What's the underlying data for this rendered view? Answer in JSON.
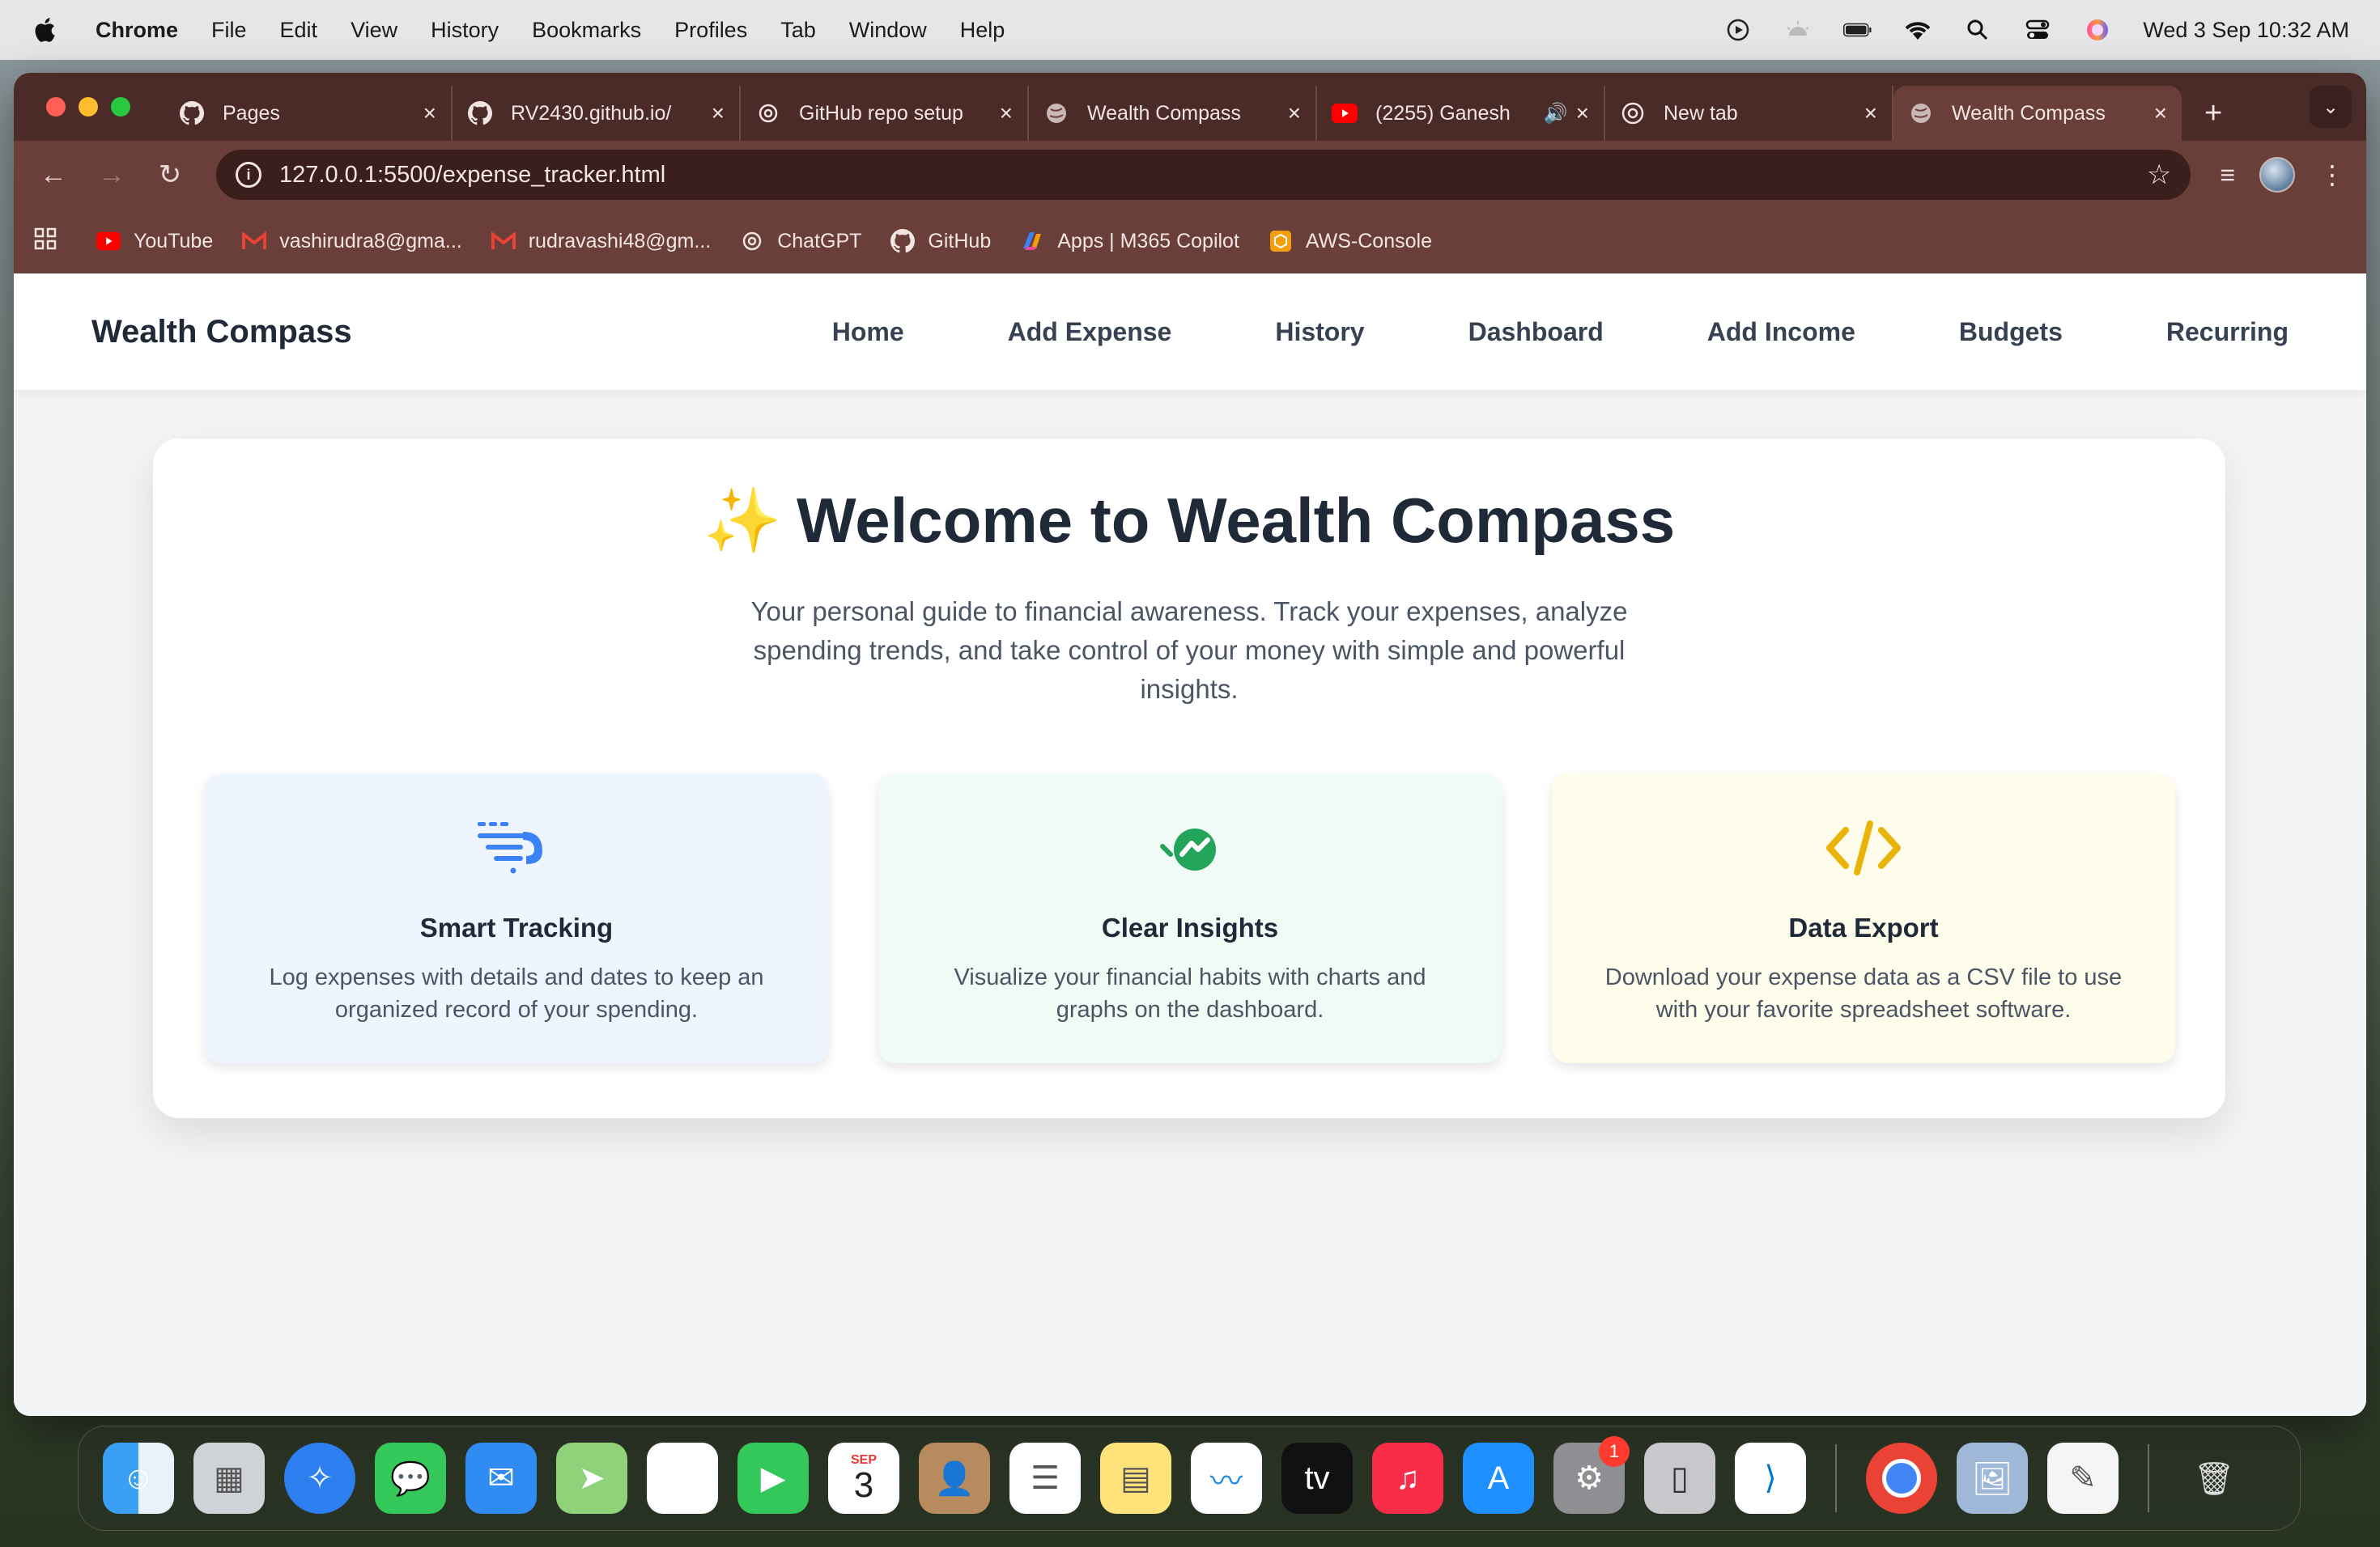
{
  "menubar": {
    "app": "Chrome",
    "items": [
      "File",
      "Edit",
      "View",
      "History",
      "Bookmarks",
      "Profiles",
      "Tab",
      "Window",
      "Help"
    ],
    "clock": "Wed 3 Sep  10:32 AM"
  },
  "tabs": [
    {
      "title": "Pages",
      "icon": "github-icon"
    },
    {
      "title": "RV2430.github.io/",
      "icon": "github-icon"
    },
    {
      "title": "GitHub repo setup",
      "icon": "chatgpt-icon"
    },
    {
      "title": "Wealth Compass",
      "icon": "globe-icon"
    },
    {
      "title": "(2255) Ganesh",
      "icon": "youtube-icon"
    },
    {
      "title": "New tab",
      "icon": "chrome-icon"
    },
    {
      "title": "Wealth Compass",
      "icon": "globe-icon",
      "active": true
    }
  ],
  "omnibox": {
    "url": "127.0.0.1:5500/expense_tracker.html"
  },
  "bookmarks": [
    {
      "label": "YouTube",
      "icon": "youtube-icon"
    },
    {
      "label": "vashirudra8@gma...",
      "icon": "gmail-icon"
    },
    {
      "label": "rudravashi48@gm...",
      "icon": "gmail-icon"
    },
    {
      "label": "ChatGPT",
      "icon": "chatgpt-icon"
    },
    {
      "label": "GitHub",
      "icon": "github-icon"
    },
    {
      "label": "Apps | M365 Copilot",
      "icon": "copilot-icon"
    },
    {
      "label": "AWS-Console",
      "icon": "aws-icon"
    }
  ],
  "site": {
    "brand": "Wealth Compass",
    "nav": [
      "Home",
      "Add Expense",
      "History",
      "Dashboard",
      "Add Income",
      "Budgets",
      "Recurring"
    ]
  },
  "hero": {
    "sparkle": "✨",
    "title": "Welcome to Wealth Compass",
    "subtitle": "Your personal guide to financial awareness. Track your expenses, analyze spending trends, and take control of your money with simple and powerful insights."
  },
  "features": [
    {
      "title": "Smart Tracking",
      "desc": "Log expenses with details and dates to keep an organized record of your spending.",
      "color": "#3b82f6"
    },
    {
      "title": "Clear Insights",
      "desc": "Visualize your financial habits with charts and graphs on the dashboard.",
      "color": "#22a55a"
    },
    {
      "title": "Data Export",
      "desc": "Download your expense data as a CSV file to use with your favorite spreadsheet software.",
      "color": "#eab308"
    }
  ],
  "dock": {
    "calendar": {
      "month": "SEP",
      "day": "3"
    },
    "settings_badge": "1"
  }
}
